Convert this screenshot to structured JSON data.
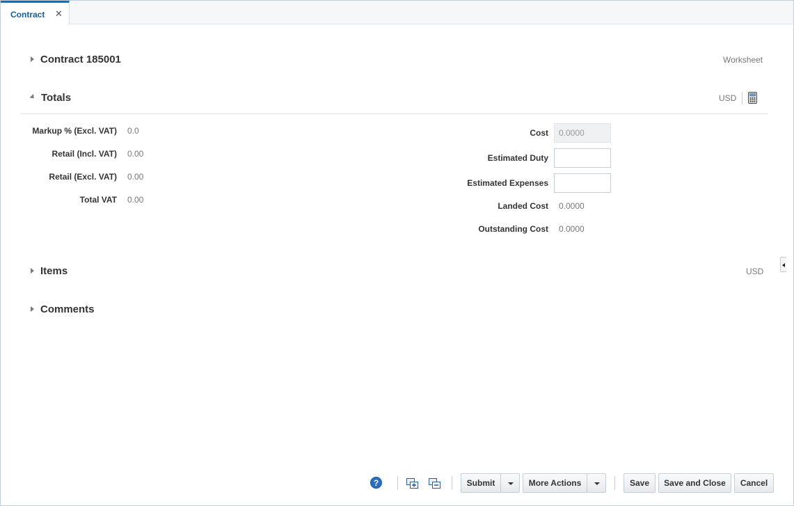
{
  "tab": {
    "label": "Contract",
    "close": "✕"
  },
  "sections": {
    "contract": {
      "title": "Contract 185001",
      "status": "Worksheet"
    },
    "totals": {
      "title": "Totals",
      "currency": "USD"
    },
    "items": {
      "title": "Items",
      "currency": "USD"
    },
    "comments": {
      "title": "Comments"
    }
  },
  "totals_left": [
    {
      "label": "Markup % (Excl. VAT)",
      "value": "0.0"
    },
    {
      "label": "Retail (Incl. VAT)",
      "value": "0.00"
    },
    {
      "label": "Retail (Excl. VAT)",
      "value": "0.00"
    },
    {
      "label": "Total VAT",
      "value": "0.00"
    }
  ],
  "totals_right": {
    "cost": {
      "label": "Cost",
      "value": "0.0000"
    },
    "estimated_duty": {
      "label": "Estimated Duty",
      "value": ""
    },
    "estimated_expenses": {
      "label": "Estimated Expenses",
      "value": ""
    },
    "landed_cost": {
      "label": "Landed Cost",
      "value": "0.0000"
    },
    "outstanding_cost": {
      "label": "Outstanding Cost",
      "value": "0.0000"
    }
  },
  "toolbar": {
    "help": "?",
    "submit": "Submit",
    "more_actions": "More Actions",
    "save": "Save",
    "save_and_close": "Save and Close",
    "cancel": "Cancel"
  },
  "icons": {
    "calculator": "calculator-icon",
    "expand_all": "expand-all-icon",
    "collapse_all": "collapse-all-icon",
    "help": "help-icon"
  },
  "colors": {
    "accent": "#0572ce",
    "tab_text": "#145c9e",
    "help_blue": "#2a6fbf"
  }
}
